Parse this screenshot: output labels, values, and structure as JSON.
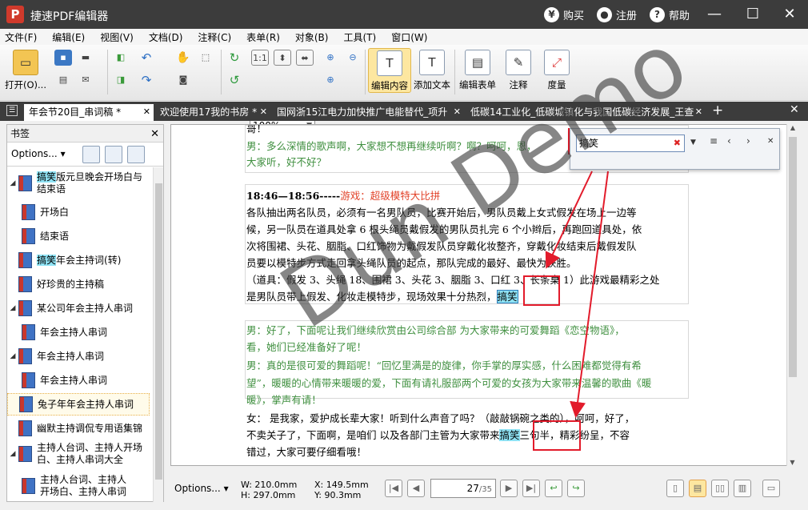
{
  "window": {
    "title": "捷速PDF编辑器",
    "app_icon_letter": "P",
    "buy": "购买",
    "register": "注册",
    "help": "帮助"
  },
  "menu": [
    "文件(F)",
    "编辑(E)",
    "视图(V)",
    "文档(D)",
    "注释(C)",
    "表单(R)",
    "对象(B)",
    "工具(T)",
    "窗口(W)"
  ],
  "toolbar": {
    "open": "打开(O)...",
    "zoom": "100%",
    "edit_content": "编辑内容",
    "add_text": "添加文本",
    "edit_form": "编辑表单",
    "annotate": "注释",
    "measure": "度量"
  },
  "tabs": [
    "年会节20目_串词稿 *",
    "欢迎使用17我的书房 *",
    "国网浙15江电力加快推广电能替代_项升",
    "低碳14工业化_低碳城镇化与我国低碳经济发展_王查"
  ],
  "sidebar": {
    "title": "书签",
    "options": "Options...",
    "items": [
      {
        "hl": "搞笑",
        "text": "版元旦晚会开场白与",
        "line2": "结束语"
      },
      {
        "text": "开场白"
      },
      {
        "text": "结束语"
      },
      {
        "hl": "搞笑",
        "text": "年会主持词(转)"
      },
      {
        "text": "好珍贵的主持稿"
      },
      {
        "text": "某公司年会主持人串词"
      },
      {
        "text": "年会主持人串词"
      },
      {
        "text": "年会主持人串词"
      },
      {
        "text": "年会主持人串词"
      },
      {
        "text": "兔子年年会主持人串词"
      },
      {
        "text": "幽默主持调侃专用语集锦"
      },
      {
        "text": "主持人台词、主持人开场",
        "line2": "白、主持人串词大全"
      },
      {
        "text": "主持人台词、主持人",
        "line2": "开场白、主持人串词"
      }
    ]
  },
  "document": {
    "p_top": "哥！",
    "p1_l1": "男：多么深情的歌声啊，大家想不想再继续听啊？啊？呵呵，恩，",
    "p1_l2": "大家听，好不好？",
    "p2_time": "18:46—18:56-----",
    "p2_game": "游戏：超级模特大比拼",
    "p2_l1": "各队抽出两名队员，必须有一名男队员，比赛开始后，男队员戴上女式假发在场上一边等",
    "p2_l2": "候，另一队员在道具处拿 6 根头绳员戴假发的男队员扎完 6 个小辫后，再跑回道具处，依",
    "p2_l3": "次将围裙、头花、胭脂、口红饰物为戴假发队员穿戴化妆整齐，穿戴化妆结束后戴假发队",
    "p2_l4": "员要以模特步方式走回拿头绳队员的起点，那队完成的最好、最快为获胜。",
    "p2_l5": "（道具：假发 3、头绳 18、围裙 3、头花 3、胭脂 3、口红 3、长条桌 1）此游戏最精彩之处",
    "p2_l6a": "是男队员带上假发、化妆走模特步，现场效果十分热烈，",
    "p2_hit": "搞笑",
    "p3_l1": "男：好了，下面呢让我们继续欣赏由公司综合部      为大家带来的可爱舞蹈《恋空物语》，",
    "p3_l2": "看，她们已经准备好了呢！",
    "p3_l3": "男：真的是很可爱的舞蹈呢！“回忆里满是的旋律，你手掌的厚实感，什么困难都觉得有希",
    "p3_l4": "望”，暖暖的心情带来暖暖的爱，下面有请礼服部两个可爱的女孩为大家带来温馨的歌曲《暖",
    "p3_l5": "暖》，掌声有请！",
    "p4_l1": "女：    是我家，爱护成长辈大家！听到什么声音了吗？（敲敲锅碗之类的），呵呵，好了，",
    "p4_l2a": "不卖关子了，下面啊，是咱们      以及各部门主管为大家带来",
    "p4_hit": "搞笑",
    "p4_l2b": "三句半，精彩纷呈，不容",
    "p4_l3": "错过，大家可要仔细看哦！"
  },
  "find": {
    "query": "搞笑"
  },
  "watermark": "Dun Demo",
  "status": {
    "options": "Options...",
    "w": "W: 210.0mm",
    "h": "H: 297.0mm",
    "x": "X: 149.5mm",
    "y": "Y:  90.3mm",
    "page": "27",
    "total": "/35"
  }
}
